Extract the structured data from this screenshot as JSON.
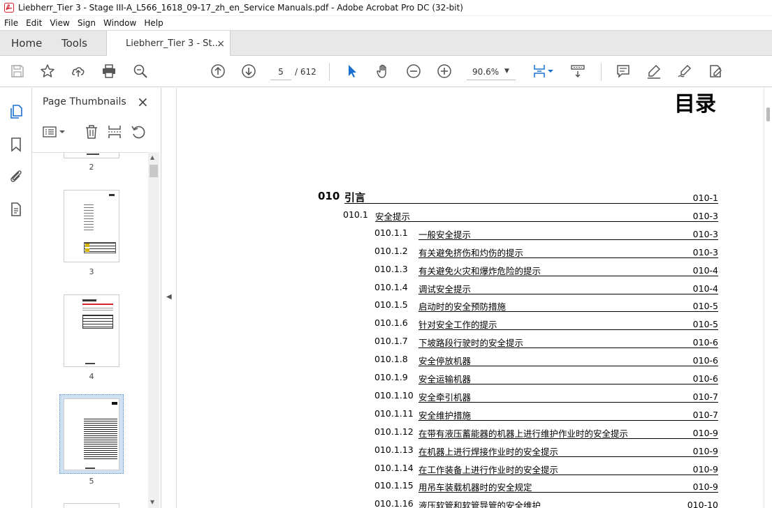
{
  "window": {
    "title": "Liebherr_Tier 3 - Stage III-A_L566_1618_09-17_zh_en_Service Manuals.pdf - Adobe Acrobat Pro DC (32-bit)"
  },
  "menu": [
    "File",
    "Edit",
    "View",
    "Sign",
    "Window",
    "Help"
  ],
  "tabs": {
    "home": "Home",
    "tools": "Tools",
    "document": "Liebherr_Tier 3 - St...",
    "close": "×"
  },
  "toolbar": {
    "page_current": "5",
    "page_total": "/ 612",
    "zoom": "90.6%"
  },
  "thumbnails": {
    "title": "Page Thumbnails",
    "close": "×",
    "pages": [
      "2",
      "3",
      "4",
      "5"
    ],
    "selected": "5"
  },
  "document": {
    "title": "目录",
    "toc": [
      {
        "num": "010",
        "title": "引言",
        "page": "010-1",
        "level": 1
      },
      {
        "num": "010.1",
        "title": "安全提示",
        "page": "010-3",
        "level": 2
      },
      {
        "num": "010.1.1",
        "title": "一般安全提示",
        "page": "010-3",
        "level": 3
      },
      {
        "num": "010.1.2",
        "title": "有关避免挤伤和灼伤的提示",
        "page": "010-3",
        "level": 3
      },
      {
        "num": "010.1.3",
        "title": "有关避免火灾和爆炸危险的提示",
        "page": "010-4",
        "level": 3
      },
      {
        "num": "010.1.4",
        "title": "调试安全提示",
        "page": "010-4",
        "level": 3
      },
      {
        "num": "010.1.5",
        "title": "启动时的安全预防措施",
        "page": "010-5",
        "level": 3
      },
      {
        "num": "010.1.6",
        "title": "针对安全工作的提示",
        "page": "010-5",
        "level": 3
      },
      {
        "num": "010.1.7",
        "title": "下坡路段行驶时的安全提示",
        "page": "010-6",
        "level": 3
      },
      {
        "num": "010.1.8",
        "title": "安全停放机器",
        "page": "010-6",
        "level": 3
      },
      {
        "num": "010.1.9",
        "title": "安全运输机器",
        "page": "010-6",
        "level": 3
      },
      {
        "num": "010.1.10",
        "title": "安全牵引机器",
        "page": "010-7",
        "level": 3
      },
      {
        "num": "010.1.11",
        "title": "安全维护措施",
        "page": "010-7",
        "level": 3
      },
      {
        "num": "010.1.12",
        "title": "在带有液压蓄能器的机器上进行维护作业时的安全提示",
        "page": "010-9",
        "level": 3
      },
      {
        "num": "010.1.13",
        "title": "在机器上进行焊接作业时的安全提示",
        "page": "010-9",
        "level": 3
      },
      {
        "num": "010.1.14",
        "title": "在工作装备上进行作业时的安全提示",
        "page": "010-9",
        "level": 3
      },
      {
        "num": "010.1.15",
        "title": "用吊车装载机器时的安全规定",
        "page": "010-9",
        "level": 3
      },
      {
        "num": "010.1.16",
        "title": "液压软管和软管导管的安全维护",
        "page": "010-10",
        "level": 3
      }
    ]
  }
}
